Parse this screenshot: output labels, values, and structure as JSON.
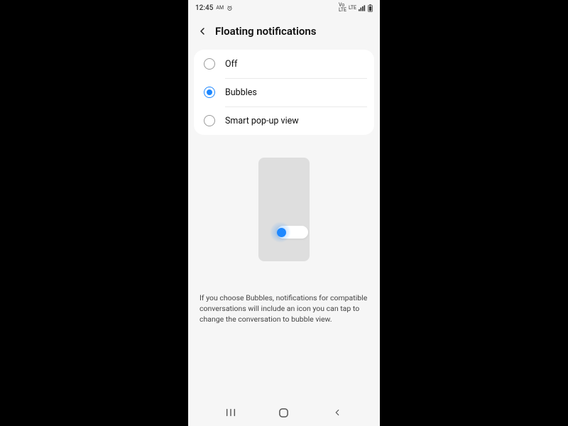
{
  "statusbar": {
    "time": "12:45",
    "ampm": "AM",
    "indicators": "VoLTE  LTE  ▲▮  ▯"
  },
  "header": {
    "title": "Floating notifications"
  },
  "options": [
    {
      "label": "Off",
      "selected": false
    },
    {
      "label": "Bubbles",
      "selected": true
    },
    {
      "label": "Smart pop-up view",
      "selected": false
    }
  ],
  "description": "If you choose Bubbles, notifications for compatible conversations will include an icon you can tap to change the conversation to bubble view.",
  "colors": {
    "accent": "#1e88ff"
  }
}
